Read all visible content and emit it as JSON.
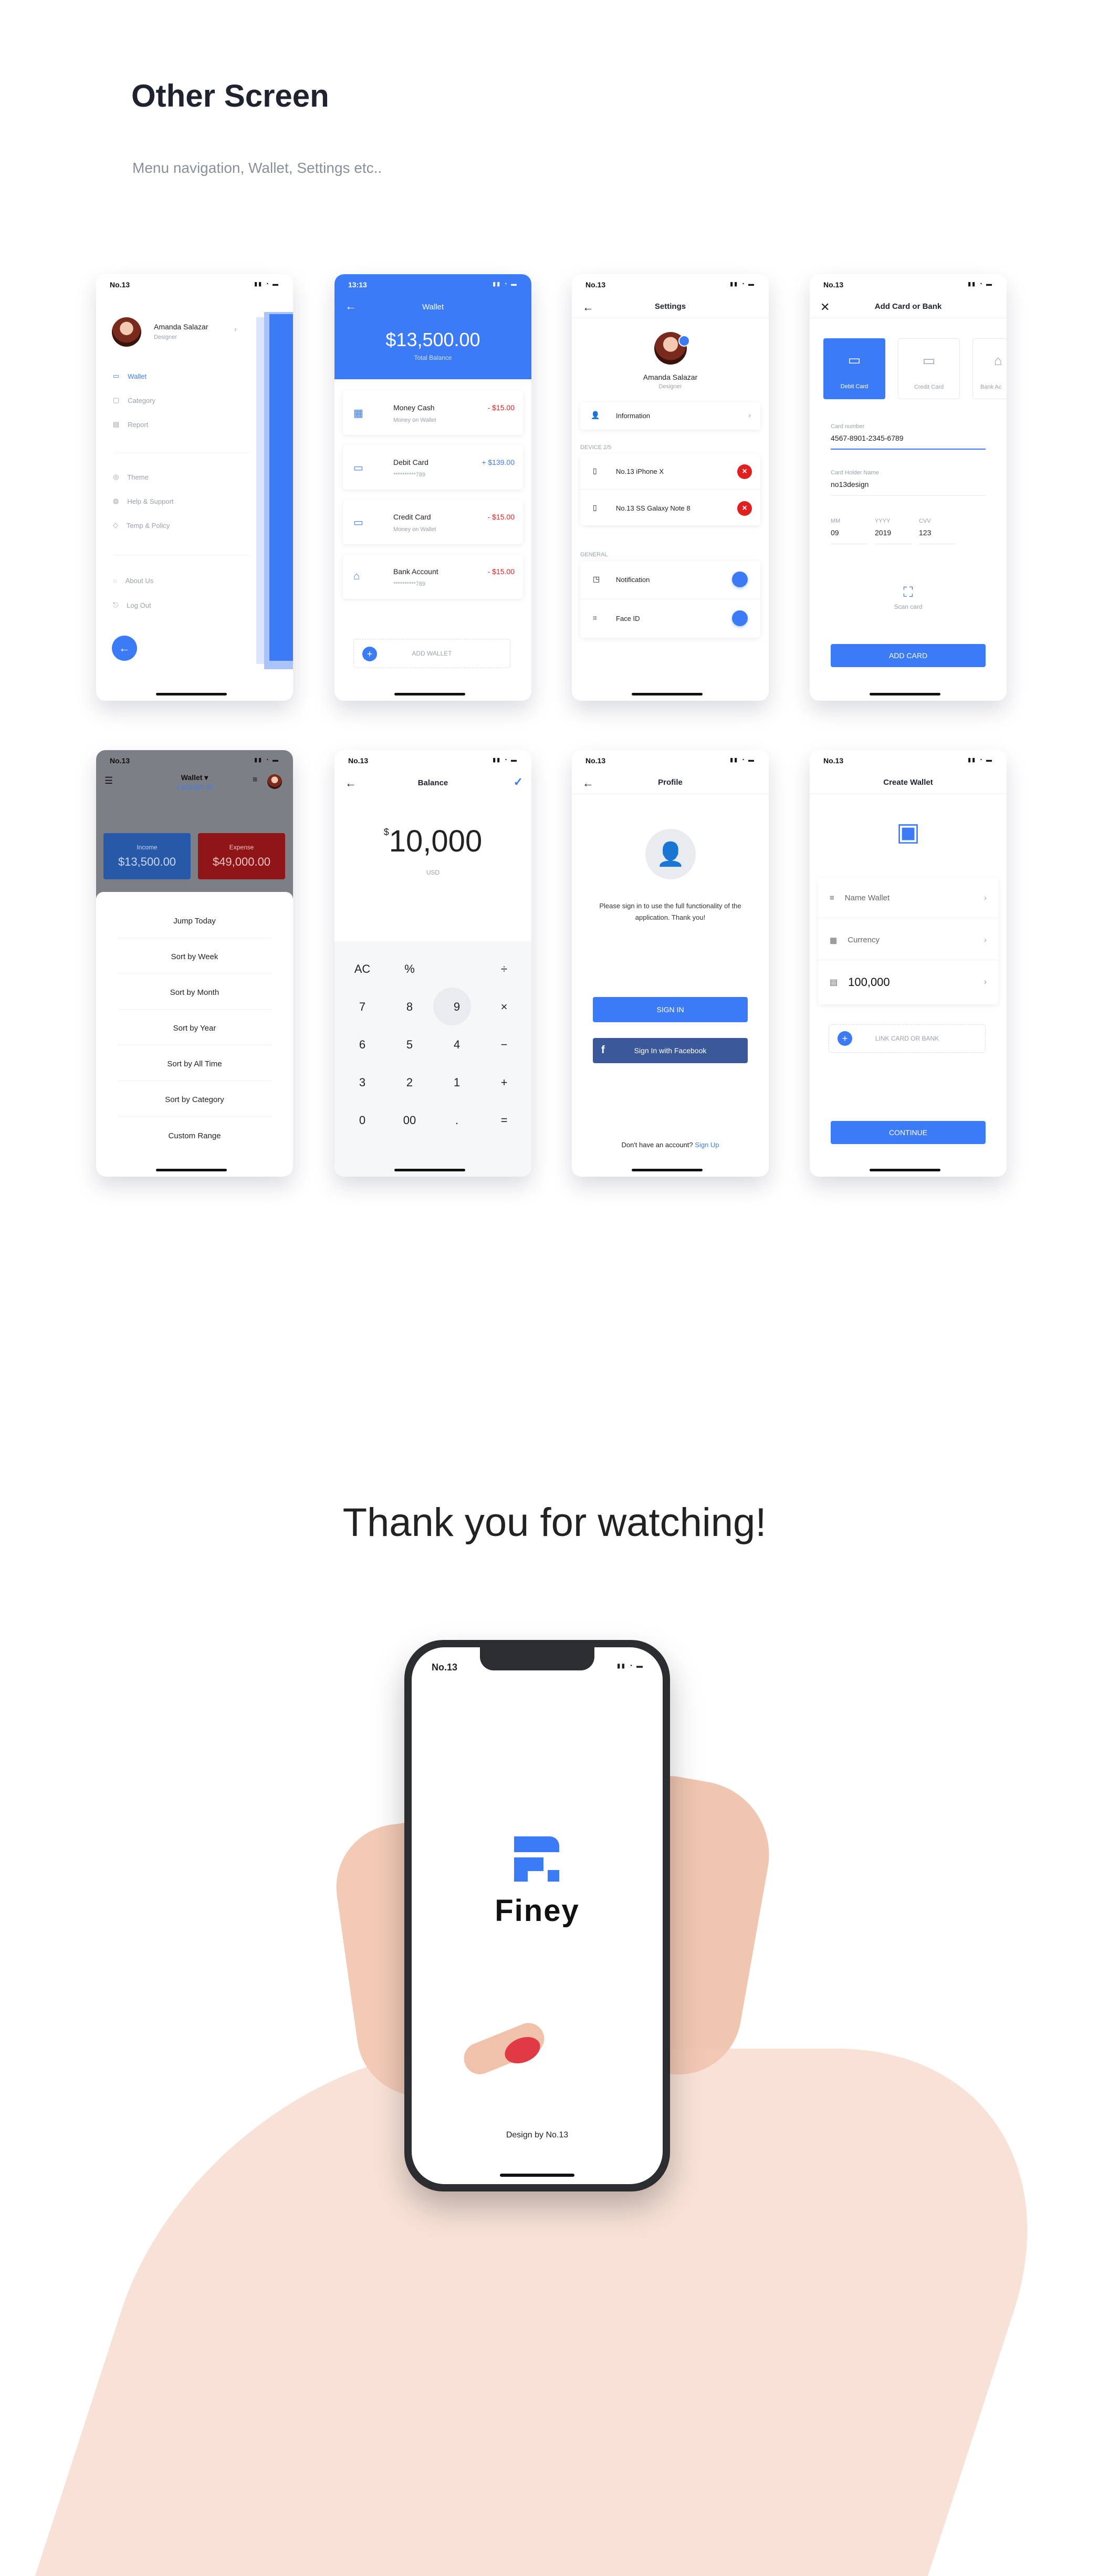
{
  "header": {
    "title": "Other Screen",
    "subtitle": "Menu navigation, Wallet, Settings etc.."
  },
  "status": {
    "brand": "No.13",
    "time": "13:13"
  },
  "menu": {
    "name": "Amanda Salazar",
    "role": "Designer",
    "items": [
      "Wallet",
      "Category",
      "Report"
    ],
    "items2": [
      "Theme",
      "Help & Support",
      "Temp & Policy"
    ],
    "items3": [
      "About Us",
      "Log Out"
    ]
  },
  "wallet": {
    "title": "Wallet",
    "total": "$13,500.00",
    "total_label": "Total Balance",
    "add": "ADD WALLET",
    "accounts": [
      {
        "name": "Money Cash",
        "sub": "Money on Wallet",
        "amount": "- $15.00"
      },
      {
        "name": "Debit Card",
        "sub": "**********789",
        "amount": "+ $139.00"
      },
      {
        "name": "Credit Card",
        "sub": "Money on Wallet",
        "amount": "- $15.00"
      },
      {
        "name": "Bank Account",
        "sub": "**********789",
        "amount": "- $15.00"
      }
    ]
  },
  "settings": {
    "title": "Settings",
    "name": "Amanda Salazar",
    "role": "Designer",
    "info": "Information",
    "device_label": "DEVICE 2/5",
    "devices": [
      "No.13 iPhone X",
      "No.13 SS Galaxy Note 8"
    ],
    "general": "GENERAL",
    "general_items": [
      "Notification",
      "Face ID"
    ]
  },
  "addcard": {
    "title": "Add  Card or Bank",
    "tabs": [
      "Debit Card",
      "Credit Card",
      "Bank Ac"
    ],
    "number_label": "Card number",
    "number": "4567-8901-2345-6789",
    "holder_label": "Card Holder Name",
    "holder": "no13design",
    "mm_label": "MM",
    "mm": "09",
    "yyyy_label": "YYYY",
    "yyyy": "2019",
    "cvv_label": "CVV",
    "cvv": "123",
    "scan": "Scan card",
    "button": "ADD CARD"
  },
  "sort": {
    "title": "Wallet",
    "amount": "+ $13,500.00",
    "income_label": "Income",
    "income": "$13,500.00",
    "expense_label": "Expense",
    "expense": "$49,000.00",
    "options": [
      "Jump Today",
      "Sort by Week",
      "Sort by Month",
      "Sort by Year",
      "Sort by All Time",
      "Sort by Category",
      "Custom Range"
    ]
  },
  "balance": {
    "title": "Balance",
    "currency": "$",
    "value": "10,000",
    "unit": "USD",
    "keys": [
      "AC",
      "%",
      "",
      "÷",
      "7",
      "8",
      "9",
      "×",
      "6",
      "5",
      "4",
      "−",
      "3",
      "2",
      "1",
      "+",
      "0",
      "00",
      ".",
      "="
    ]
  },
  "profile": {
    "title": "Profile",
    "message": "Please sign in to use the full functionality of the application. Thank you!",
    "signin": "SIGN IN",
    "facebook": "Sign In with Facebook",
    "no_account": "Don't have an account?",
    "signup": "Sign Up"
  },
  "createwallet": {
    "title": "Create Wallet",
    "fields": [
      "Name Wallet",
      "Currency",
      "100,000"
    ],
    "link": "LINK CARD OR BANK",
    "button": "CONTINUE"
  },
  "thanks": "Thank you for watching!",
  "splash": {
    "brand": "No.13",
    "app": "Finey",
    "credit": "Design by No.13"
  },
  "colors": {
    "accent": "#3b7cf6",
    "danger": "#e02020",
    "text": "#1f2330"
  }
}
